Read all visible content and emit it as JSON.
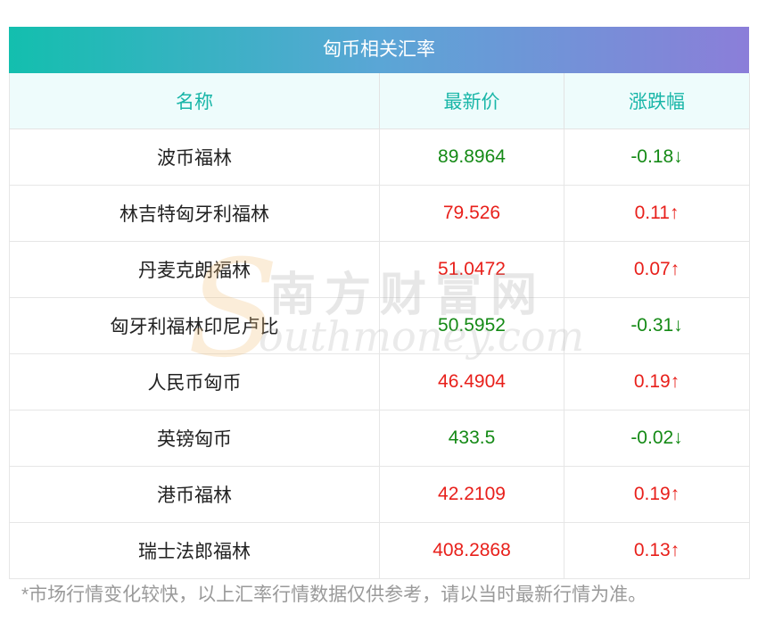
{
  "table": {
    "title": "匈币相关汇率",
    "headers": [
      "名称",
      "最新价",
      "涨跌幅"
    ],
    "rows": [
      {
        "name": "波币福林",
        "price": "89.8964",
        "change": "-0.18↓",
        "direction": "down"
      },
      {
        "name": "林吉特匈牙利福林",
        "price": "79.526",
        "change": "0.11↑",
        "direction": "up"
      },
      {
        "name": "丹麦克朗福林",
        "price": "51.0472",
        "change": "0.07↑",
        "direction": "up"
      },
      {
        "name": "匈牙利福林印尼卢比",
        "price": "50.5952",
        "change": "-0.31↓",
        "direction": "down"
      },
      {
        "name": "人民币匈币",
        "price": "46.4904",
        "change": "0.19↑",
        "direction": "up"
      },
      {
        "name": "英镑匈币",
        "price": "433.5",
        "change": "-0.02↓",
        "direction": "down"
      },
      {
        "name": "港币福林",
        "price": "42.2109",
        "change": "0.19↑",
        "direction": "up"
      },
      {
        "name": "瑞士法郎福林",
        "price": "408.2868",
        "change": "0.13↑",
        "direction": "up"
      }
    ]
  },
  "footnote": "*市场行情变化较快，以上汇率行情数据仅供参考，请以当时最新行情为准。",
  "watermark": {
    "cn": "南方财富网",
    "en": "outhmoney.com",
    "letter": "S"
  },
  "colors": {
    "up": "#e8201b",
    "down": "#158a16",
    "header_text": "#19b6a8",
    "title_gradient": [
      "#13bfae",
      "#8b7ed9"
    ]
  }
}
